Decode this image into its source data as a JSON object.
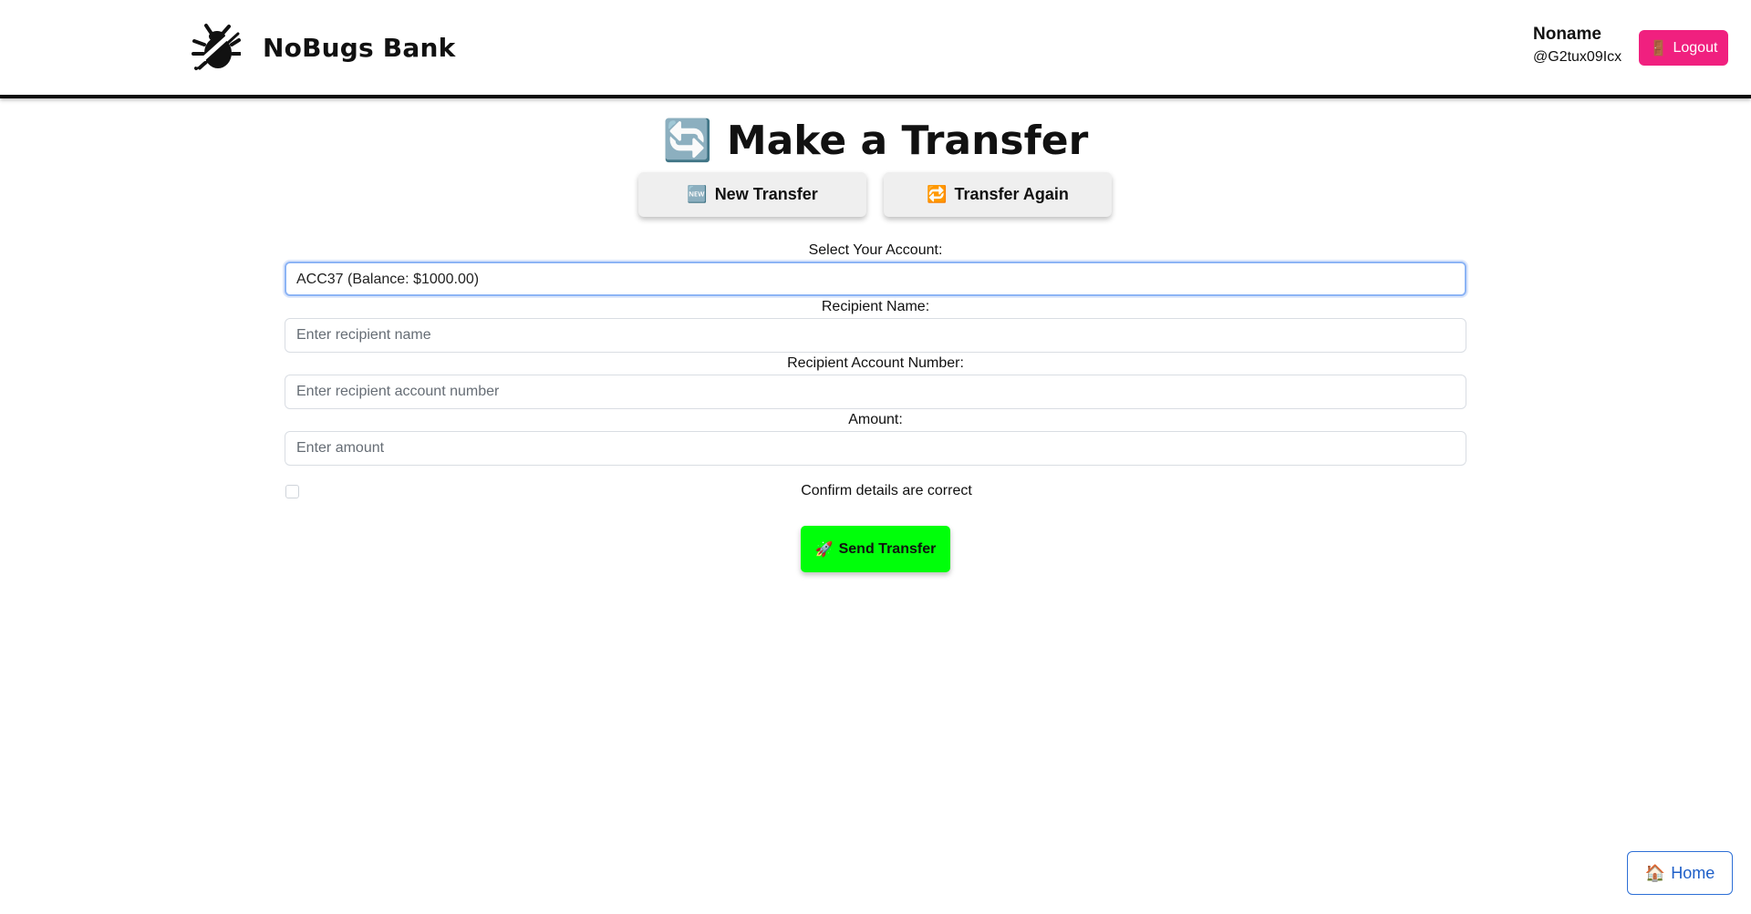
{
  "header": {
    "brand_name": "NoBugs Bank",
    "user_name": "Noname",
    "user_handle": "@G2tux09Icx",
    "logout_icon": "🚪",
    "logout_label": "Logout"
  },
  "title": {
    "icon": "🔄",
    "text": "Make a Transfer"
  },
  "tabs": [
    {
      "icon": "🆕",
      "label": "New Transfer"
    },
    {
      "icon": "🔁",
      "label": "Transfer Again"
    }
  ],
  "form": {
    "account_label": "Select Your Account:",
    "account_selected": "ACC37 (Balance: $1000.00)",
    "recipient_name_label": "Recipient Name:",
    "recipient_name_placeholder": "Enter recipient name",
    "recipient_account_label": "Recipient Account Number:",
    "recipient_account_placeholder": "Enter recipient account number",
    "amount_label": "Amount:",
    "amount_placeholder": "Enter amount",
    "confirm_label": "Confirm details are correct",
    "send_icon": "🚀",
    "send_label": "Send Transfer"
  },
  "footer": {
    "home_icon": "🏠",
    "home_label": "Home"
  },
  "colors": {
    "logout_bg": "#f0207f",
    "send_bg": "#00ff0a",
    "home_border": "#2d6fd6",
    "focus_ring": "#8cb4f5"
  }
}
